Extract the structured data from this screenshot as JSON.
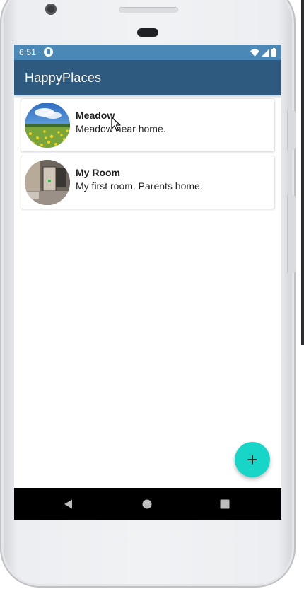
{
  "status_bar": {
    "time": "6:51",
    "icons": [
      "app-notification-icon",
      "wifi-icon",
      "cell-signal-icon",
      "battery-icon"
    ]
  },
  "app_bar": {
    "title": "HappyPlaces"
  },
  "places": [
    {
      "title": "Meadow",
      "description": "Meadow near home.",
      "image": "meadow-thumbnail"
    },
    {
      "title": "My Room",
      "description": "My first room. Parents home.",
      "image": "room-thumbnail"
    }
  ],
  "fab": {
    "label": "+",
    "icon": "add-icon"
  },
  "navigation": {
    "buttons": [
      "back-icon",
      "home-icon",
      "recents-icon"
    ]
  },
  "colors": {
    "status_bar": "#4a88b8",
    "app_bar": "#2f5a80",
    "fab": "#17d6c8",
    "nav_bar": "#000000"
  }
}
